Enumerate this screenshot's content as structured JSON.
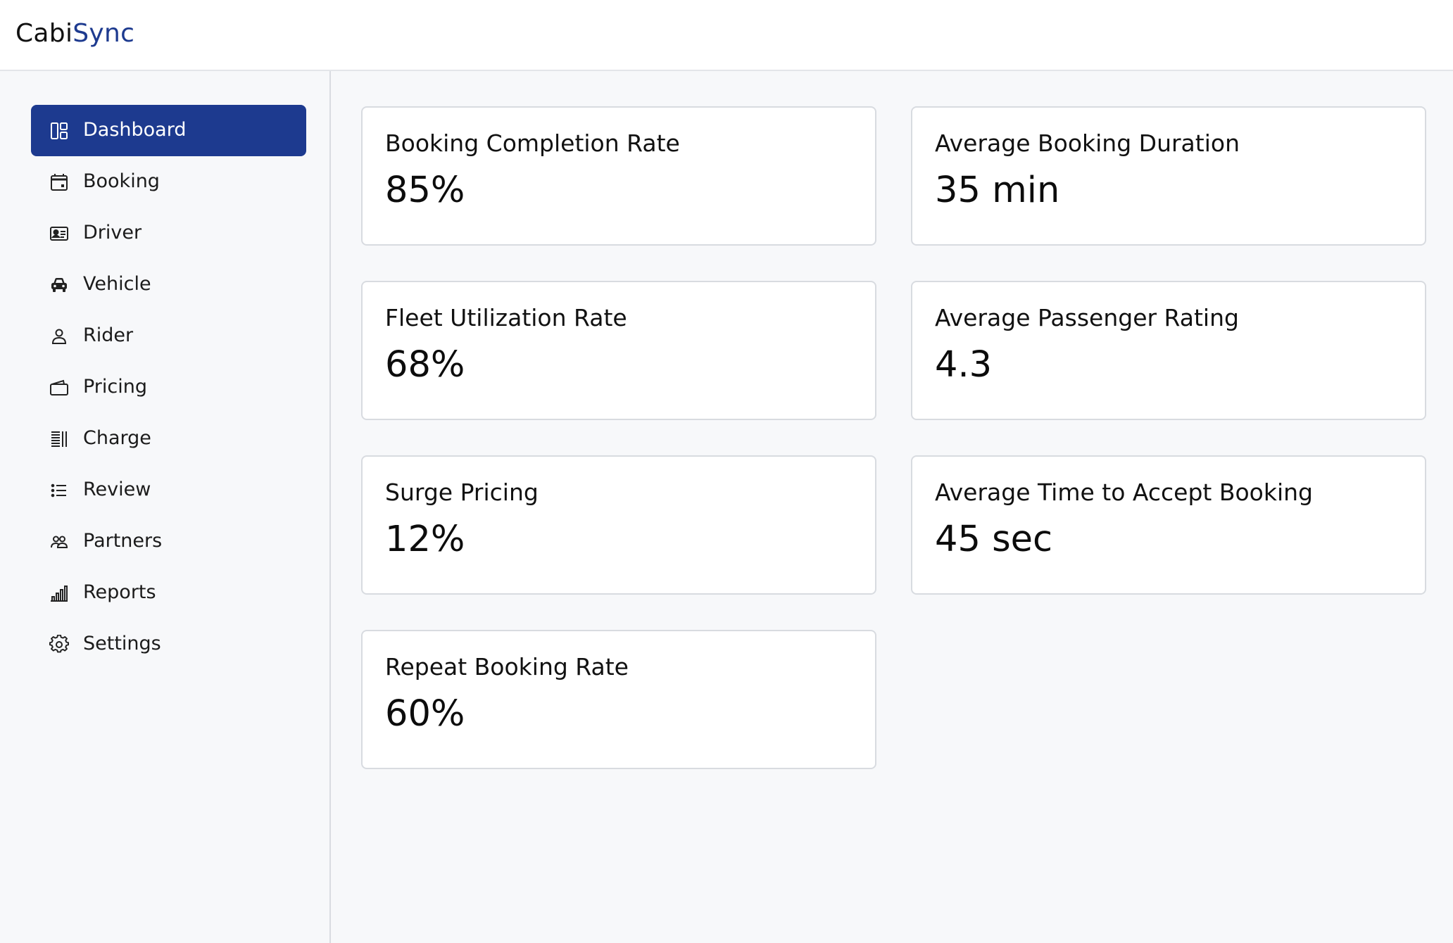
{
  "header": {
    "logo_part1": "Cabi",
    "logo_part2": "Sync"
  },
  "sidebar": {
    "items": [
      {
        "label": "Dashboard",
        "icon": "dashboard-icon",
        "active": true
      },
      {
        "label": "Booking",
        "icon": "calendar-icon"
      },
      {
        "label": "Driver",
        "icon": "id-card-icon"
      },
      {
        "label": "Vehicle",
        "icon": "car-icon"
      },
      {
        "label": "Rider",
        "icon": "user-icon"
      },
      {
        "label": "Pricing",
        "icon": "wallet-icon"
      },
      {
        "label": "Charge",
        "icon": "receipt-icon"
      },
      {
        "label": "Review",
        "icon": "list-icon"
      },
      {
        "label": "Partners",
        "icon": "users-icon"
      },
      {
        "label": "Reports",
        "icon": "bar-chart-icon"
      },
      {
        "label": "Settings",
        "icon": "gear-icon"
      }
    ]
  },
  "metrics": [
    {
      "title": "Booking Completion Rate",
      "value": "85%"
    },
    {
      "title": "Average Booking Duration",
      "value": "35 min"
    },
    {
      "title": "Fleet Utilization Rate",
      "value": "68%"
    },
    {
      "title": "Average Passenger Rating",
      "value": "4.3"
    },
    {
      "title": "Surge Pricing",
      "value": "12%"
    },
    {
      "title": "Average Time to Accept Booking",
      "value": "45 sec"
    },
    {
      "title": "Repeat Booking Rate",
      "value": "60%"
    }
  ],
  "colors": {
    "accent": "#1d3a8f",
    "background": "#f7f8fa",
    "card_border": "#d8dbe0"
  }
}
